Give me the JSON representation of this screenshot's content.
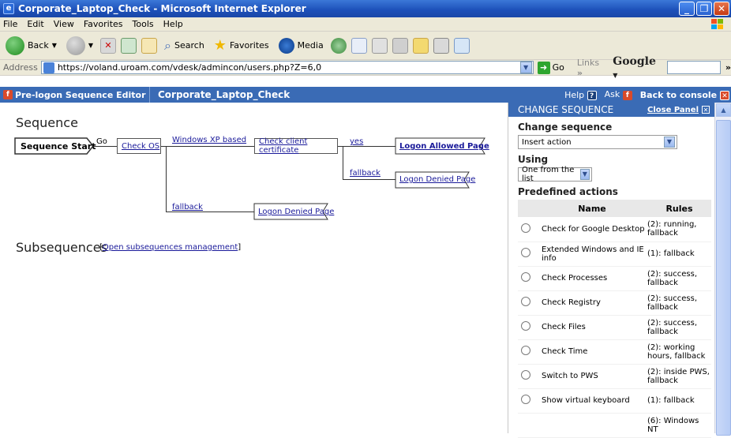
{
  "window": {
    "title": "Corporate_Laptop_Check - Microsoft Internet Explorer"
  },
  "menu": [
    "File",
    "Edit",
    "View",
    "Favorites",
    "Tools",
    "Help"
  ],
  "toolbar": {
    "back": "Back",
    "search": "Search",
    "favorites": "Favorites",
    "media": "Media"
  },
  "address": {
    "label": "Address",
    "url": "https://voland.uroam.com/vdesk/admincon/users.php?Z=6,0",
    "go": "Go",
    "links": "Links",
    "links_more": "»",
    "google": "Google",
    "more": "»"
  },
  "app": {
    "editor_title": "Pre-logon Sequence Editor",
    "sequence_name": "Corporate_Laptop_Check",
    "help": "Help",
    "ask": "Ask",
    "back_to_console": "Back to console"
  },
  "sequence": {
    "heading": "Sequence",
    "start": "Sequence Start",
    "go": "Go",
    "check_os": "Check OS",
    "windows_xp": "Windows XP based",
    "check_cert": "Check client certificate",
    "yes": "yes",
    "logon_allowed": "Logon Allowed Page",
    "fallback1": "fallback",
    "logon_denied1": "Logon Denied Page",
    "fallback2": "fallback",
    "logon_denied2": "Logon Denied Page"
  },
  "subsequences": {
    "heading": "Subsequences",
    "link": "Open subsequences management",
    "bracket_open": "[",
    "bracket_close": "]"
  },
  "panel": {
    "title": "CHANGE SEQUENCE",
    "close": "Close Panel",
    "change_heading": "Change sequence",
    "change_value": "Insert action",
    "using_heading": "Using",
    "using_value": "One from the list",
    "predefined_heading": "Predefined actions",
    "col_name": "Name",
    "col_rules": "Rules",
    "actions": [
      {
        "name": "Check for Google Desktop",
        "rules": "(2): running, fallback"
      },
      {
        "name": "Extended Windows and IE info",
        "rules": "(1): fallback"
      },
      {
        "name": "Check Processes",
        "rules": "(2): success, fallback"
      },
      {
        "name": "Check Registry",
        "rules": "(2): success, fallback"
      },
      {
        "name": "Check Files",
        "rules": "(2): success, fallback"
      },
      {
        "name": "Check Time",
        "rules": "(2): working hours, fallback"
      },
      {
        "name": "Switch to PWS",
        "rules": "(2): inside PWS, fallback"
      },
      {
        "name": "Show virtual keyboard",
        "rules": "(1): fallback"
      },
      {
        "name": "",
        "rules": "(6): Windows NT"
      }
    ]
  },
  "colors": {
    "titlebar": "#1c4fb8",
    "app_header": "#3a6bb5",
    "link": "#1a1a9a"
  }
}
